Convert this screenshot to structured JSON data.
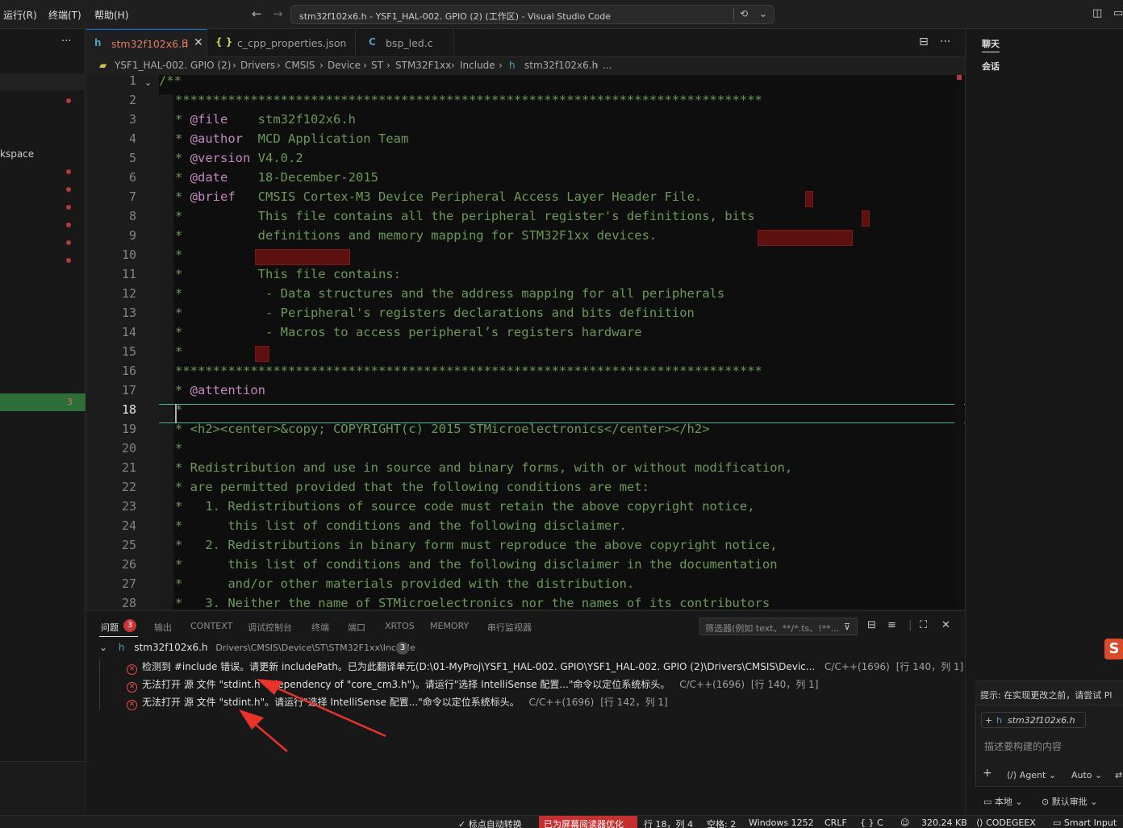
{
  "menu": {
    "run": "运行(R)",
    "terminal": "终端(T)",
    "help": "帮助(H)"
  },
  "window_title": "stm32f102x6.h - YSF1_HAL-002. GPIO (2) (工作区) - Visual Studio Code",
  "sidebar": {
    "workspace_label": "kspace",
    "problem_count": "3"
  },
  "tabs": [
    {
      "label": "stm32f102x6.h",
      "count": "3",
      "icon": "h",
      "active": true
    },
    {
      "label": "c_cpp_properties.json",
      "icon": "{ }"
    },
    {
      "label": "bsp_led.c",
      "icon": "C"
    }
  ],
  "breadcrumb": [
    "YSF1_HAL-002. GPIO (2)",
    "Drivers",
    "CMSIS",
    "Device",
    "ST",
    "STM32F1xx",
    "Include",
    "stm32f102x6.h",
    "..."
  ],
  "editor": {
    "current_line": "18",
    "line_numbers": [
      "1",
      "2",
      "3",
      "4",
      "5",
      "6",
      "7",
      "8",
      "9",
      "10",
      "11",
      "12",
      "13",
      "14",
      "15",
      "16",
      "17",
      "18",
      "19",
      "20",
      "21",
      "22",
      "23",
      "24",
      "25",
      "26",
      "27",
      "28"
    ],
    "lines": [
      "/**",
      "******************************************************************************",
      "* @file    stm32f102x6.h",
      "* @author  MCD Application Team",
      "* @version V4.0.2",
      "* @date    18-December-2015",
      "* @brief   CMSIS Cortex-M3 Device Peripheral Access Layer Header File.",
      "*          This file contains all the peripheral register's definitions, bits",
      "*          definitions and memory mapping for STM32F1xx devices.",
      "*",
      "*          This file contains:",
      "*           - Data structures and the address mapping for all peripherals",
      "*           - Peripheral's registers declarations and bits definition",
      "*           - Macros to access peripheral’s registers hardware",
      "*",
      "******************************************************************************",
      "* @attention",
      "*",
      "* <h2><center>&copy; COPYRIGHT(c) 2015 STMicroelectronics</center></h2>",
      "*",
      "* Redistribution and use in source and binary forms, with or without modification,",
      "* are permitted provided that the following conditions are met:",
      "*   1. Redistributions of source code must retain the above copyright notice,",
      "*      this list of conditions and the following disclaimer.",
      "*   2. Redistributions in binary form must reproduce the above copyright notice,",
      "*      this list of conditions and the following disclaimer in the documentation",
      "*      and/or other materials provided with the distribution.",
      "*   3. Neither the name of STMicroelectronics nor the names of its contributors"
    ]
  },
  "panel": {
    "tabs": [
      "问题",
      "输出",
      "CONTEXT",
      "调试控制台",
      "终端",
      "端口",
      "XRTOS",
      "MEMORY",
      "串行监视器"
    ],
    "problem_count": "3",
    "filter_placeholder": "筛选器(例如 text、**/*.ts、!**...",
    "file": {
      "name": "stm32f102x6.h",
      "path": "Drivers\\CMSIS\\Device\\ST\\STM32F1xx\\Include",
      "count": "3"
    },
    "problems": [
      {
        "message": "检测到 #include 错误。请更新 includePath。已为此翻译单元(D:\\01-MyProj\\YSF1_HAL-002. GPIO\\YSF1_HAL-002. GPIO (2)\\Drivers\\CMSIS\\Devic...",
        "source": "C/C++(1696)",
        "location": "[行 140，列 1]"
      },
      {
        "message": "无法打开 源 文件 \"stdint.h\" (dependency of \"core_cm3.h\")。请运行\"选择 IntelliSense 配置...\"命令以定位系统标头。",
        "source": "C/C++(1696)",
        "location": "[行 140，列 1]"
      },
      {
        "message": "无法打开 源 文件 \"stdint.h\"。请运行\"选择 IntelliSense 配置...\"命令以定位系统标头。",
        "source": "C/C++(1696)",
        "location": "[行 142，列 1]"
      }
    ]
  },
  "chat": {
    "title": "聊天",
    "subtitle": "会话",
    "tip": "提示: 在实现更改之前，请尝试 Pl",
    "file_chip": "stm32f102x6.h",
    "placeholder": "描述要构建的内容",
    "agent": "Agent",
    "auto": "Auto",
    "local": "本地",
    "review": "默认审批"
  },
  "status": {
    "autoswitch": "✓ 标点自动转换",
    "screen_reader": "已为屏幕阅读器优化",
    "position": "行 18，列 4",
    "spaces": "空格: 2",
    "encoding": "Windows 1252",
    "eol": "CRLF",
    "language": "C",
    "size": "320.24 KB",
    "codegeex": "CODEGEEX",
    "smart_input": "Smart Input"
  },
  "colors": {
    "accent": "#0078d4",
    "error": "#f14c4c",
    "comment": "#6a9955",
    "tab_active": "#e07a5f"
  }
}
